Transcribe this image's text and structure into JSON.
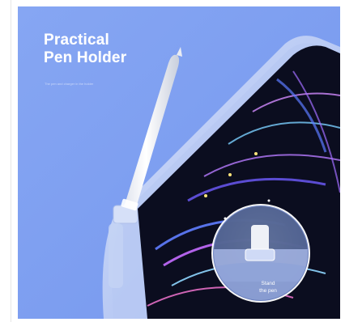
{
  "product": {
    "headline_line1": "Practical",
    "headline_line2": "Pen Holder",
    "subtext": "The pen and charger in the holder",
    "zoom_caption_line1": "Stand",
    "zoom_caption_line2": "the pen",
    "colors": {
      "background": "#7fa1f1",
      "case_frame": "#c9d6f5",
      "screen": "#0b0d1f",
      "pen": "#f4f5f8",
      "headline_text": "#ffffff"
    }
  }
}
